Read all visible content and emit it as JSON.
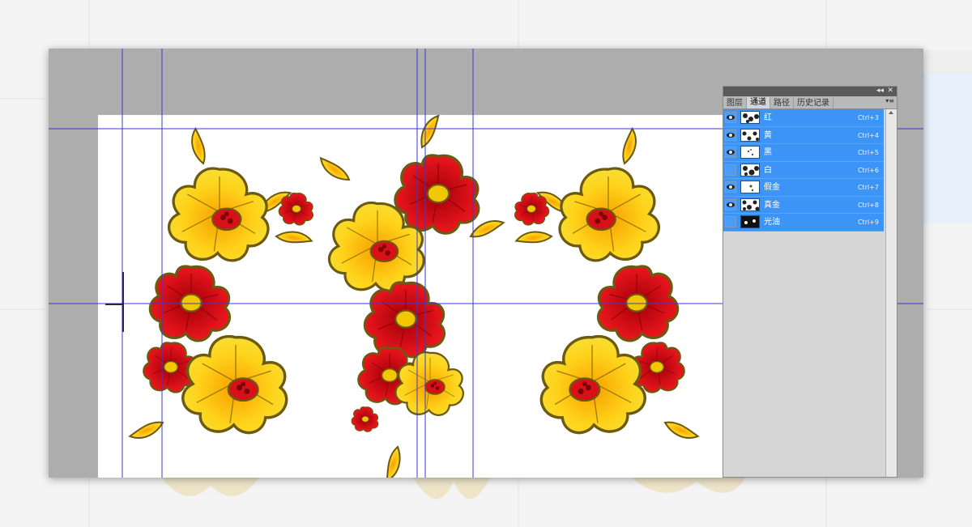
{
  "channels_panel": {
    "collapse_glyph": "◂◂",
    "close_glyph": "✕",
    "menu_glyph": "▾≡",
    "tabs": [
      {
        "label": "图层",
        "active": false
      },
      {
        "label": "通道",
        "active": true
      },
      {
        "label": "路径",
        "active": false
      },
      {
        "label": "历史记录",
        "active": false
      }
    ],
    "channels": [
      {
        "name": "红",
        "shortcut": "Ctrl+3",
        "visible": true
      },
      {
        "name": "黄",
        "shortcut": "Ctrl+4",
        "visible": true
      },
      {
        "name": "黑",
        "shortcut": "Ctrl+5",
        "visible": true
      },
      {
        "name": "白",
        "shortcut": "Ctrl+6",
        "visible": false
      },
      {
        "name": "假金",
        "shortcut": "Ctrl+7",
        "visible": true
      },
      {
        "name": "真金",
        "shortcut": "Ctrl+8",
        "visible": true
      },
      {
        "name": "光油",
        "shortcut": "Ctrl+9",
        "visible": false
      }
    ],
    "selection_color": "#3c94f6"
  },
  "canvas": {
    "background": "#ffffff",
    "guide_color": "#3a3ad0",
    "flower_colors": {
      "red": "#e0121a",
      "yellow": "#f5c200",
      "outline": "#6b5a10"
    }
  }
}
